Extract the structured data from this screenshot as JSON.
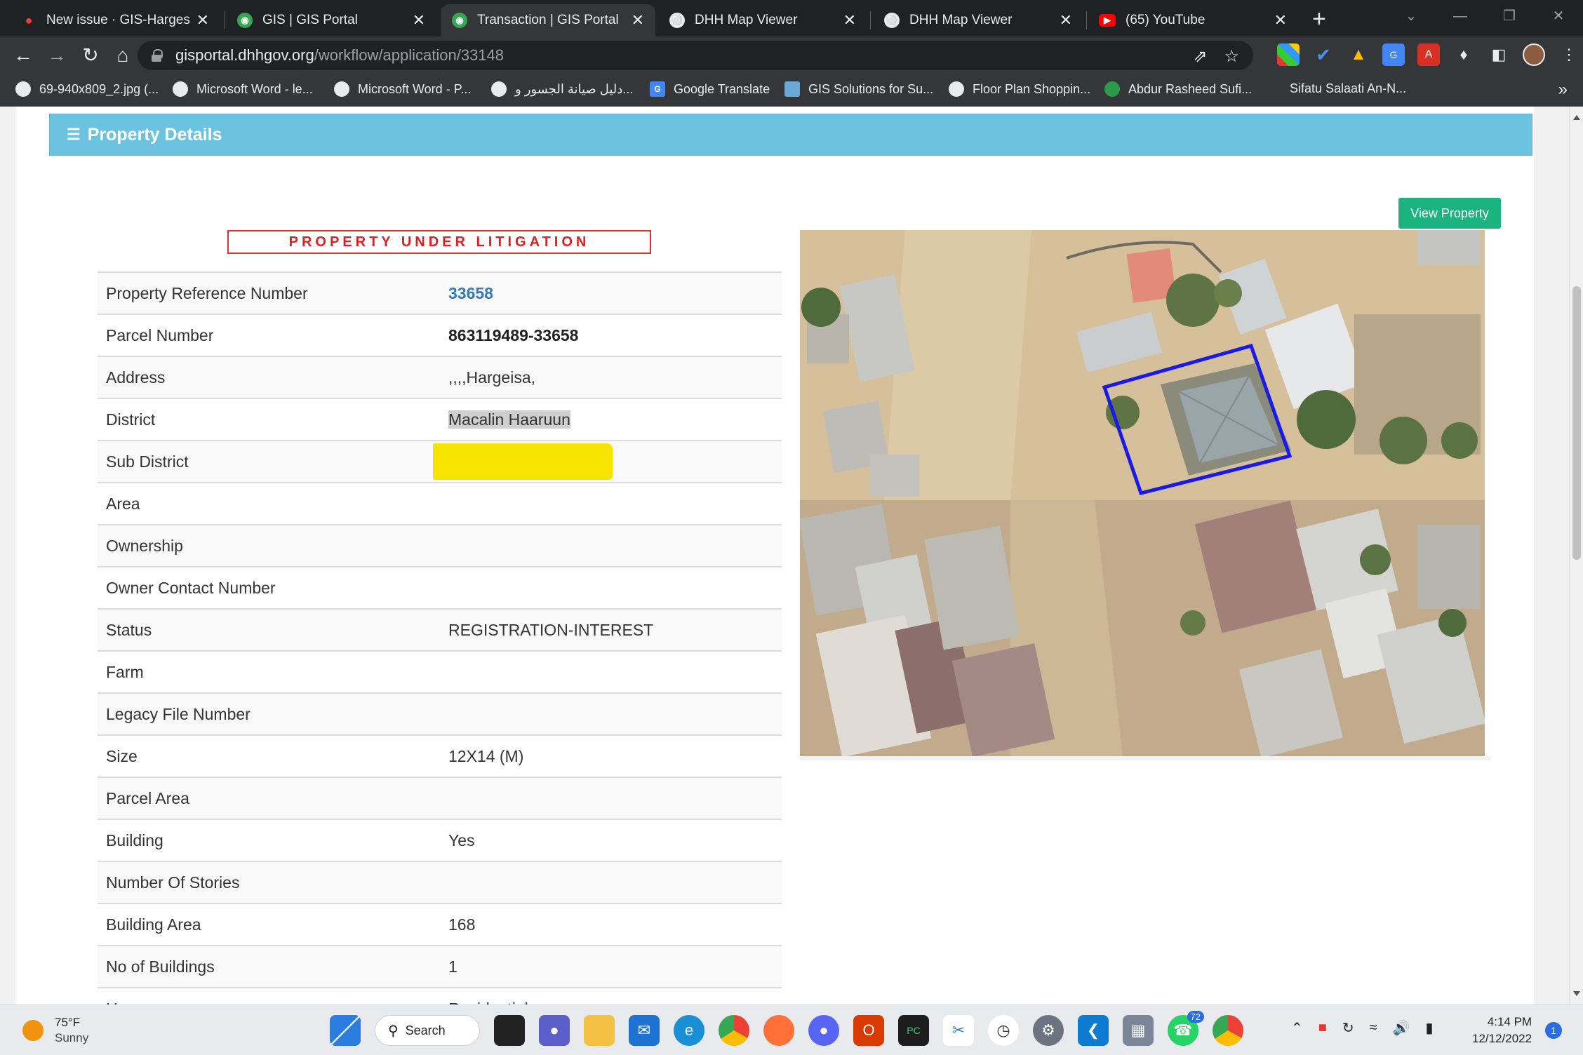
{
  "browser": {
    "tabs": [
      {
        "title": "New issue · GIS-Hargesia",
        "icon": "github-icon",
        "active": false
      },
      {
        "title": "GIS | GIS Portal",
        "icon": "gis-portal-icon",
        "active": false
      },
      {
        "title": "Transaction | GIS Portal",
        "icon": "gis-portal-icon",
        "active": true
      },
      {
        "title": "DHH Map Viewer",
        "icon": "globe-icon",
        "active": false
      },
      {
        "title": "DHH Map Viewer",
        "icon": "globe-icon",
        "active": false
      },
      {
        "title": "(65) YouTube",
        "icon": "youtube-icon",
        "active": false
      }
    ],
    "url_host": "gisportal.dhhgov.org",
    "url_path": "/workflow/application/33148",
    "bookmarks": [
      "69-940x809_2.jpg (...",
      "Microsoft Word - le...",
      "Microsoft Word - P...",
      "دليل صيانة الجسور و...",
      "Google Translate",
      "GIS Solutions for Su...",
      "Floor Plan Shoppin...",
      "Abdur Rasheed Sufi...",
      "Sifatu Salaati An-N..."
    ]
  },
  "page": {
    "section_title": "Property Details",
    "litigation_banner": "PROPERTY UNDER LITIGATION",
    "view_property_label": "View Property",
    "rows": [
      {
        "label": "Property Reference Number",
        "value": "33658"
      },
      {
        "label": "Parcel Number",
        "value": "863119489-33658"
      },
      {
        "label": "Address",
        "value": ",,,,Hargeisa,"
      },
      {
        "label": "District",
        "value": "Macalin Haaruun"
      },
      {
        "label": "Sub District",
        "value": ""
      },
      {
        "label": "Area",
        "value": ""
      },
      {
        "label": "Ownership",
        "value": ""
      },
      {
        "label": "Owner Contact Number",
        "value": ""
      },
      {
        "label": "Status",
        "value": "REGISTRATION-INTEREST"
      },
      {
        "label": "Farm",
        "value": ""
      },
      {
        "label": "Legacy File Number",
        "value": ""
      },
      {
        "label": "Size",
        "value": "12X14 (M)"
      },
      {
        "label": "Parcel Area",
        "value": ""
      },
      {
        "label": "Building",
        "value": "Yes"
      },
      {
        "label": "Number Of Stories",
        "value": ""
      },
      {
        "label": "Building Area",
        "value": "168"
      },
      {
        "label": "No of Buildings",
        "value": "1"
      },
      {
        "label": "Usage",
        "value": "Residential"
      }
    ]
  },
  "taskbar": {
    "temperature": "75°F",
    "condition": "Sunny",
    "search_label": "Search",
    "whatsapp_badge": "72",
    "time": "4:14 PM",
    "date": "12/12/2022",
    "notification_count": "1"
  },
  "colors": {
    "panel_header": "#6cc3e0",
    "view_button": "#1bb47e",
    "litigation_red": "#e02020",
    "link_blue": "#337ab7",
    "parcel_outline": "#1a1ae6",
    "highlighter_yellow": "#f5e400"
  }
}
